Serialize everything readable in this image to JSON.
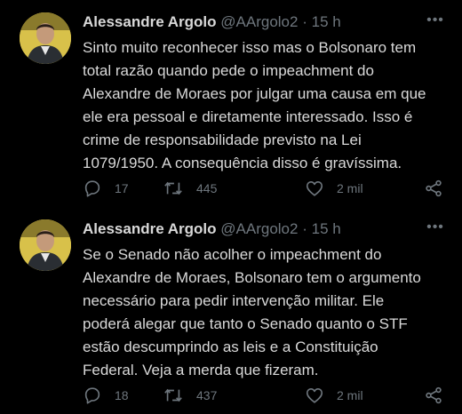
{
  "tweets": [
    {
      "author_name": "Alessandre Argolo",
      "handle": "@AArgolo2",
      "separator": "·",
      "time": "15 h",
      "more": "•••",
      "lines": [
        "Sinto muito reconhecer isso mas o Bolsonaro tem",
        "total razão quando pede o impeachment do",
        "Alexandre de Moraes por julgar uma causa em que",
        "ele era pessoal e diretamente interessado. Isso é",
        "crime de responsabilidade previsto  na Lei",
        "1079/1950. A consequência disso é gravíssima."
      ],
      "replies": "17",
      "retweets": "445",
      "likes": "2 mil"
    },
    {
      "author_name": "Alessandre Argolo",
      "handle": "@AArgolo2",
      "separator": "·",
      "time": "15 h",
      "more": "•••",
      "lines": [
        "Se o Senado não acolher o impeachment do",
        "Alexandre de Moraes, Bolsonaro tem o argumento",
        "necessário para pedir intervenção militar. Ele",
        "poderá alegar que tanto o Senado quanto o STF",
        "estão descumprindo as leis e a Constituição",
        "Federal. Veja a merda que fizeram."
      ],
      "replies": "18",
      "retweets": "437",
      "likes": "2 mil"
    }
  ],
  "icons": {
    "reply": "reply-icon",
    "retweet": "retweet-icon",
    "like": "like-icon",
    "share": "share-icon",
    "more": "more-icon"
  },
  "colors": {
    "background": "#000000",
    "text": "#d9d9d9",
    "muted": "#6e767d",
    "avatar_bg": "#d8c14a"
  }
}
